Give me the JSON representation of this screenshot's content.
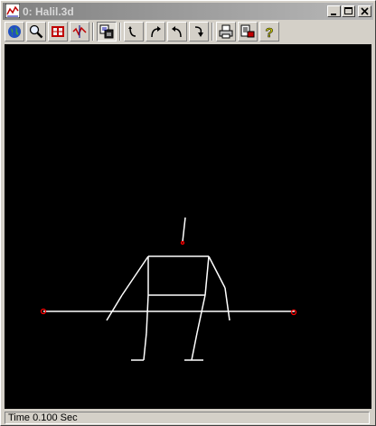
{
  "window": {
    "title": "0: Halil.3d",
    "caption_buttons": [
      "minimize",
      "maximize",
      "close"
    ]
  },
  "toolbar": {
    "groups": [
      [
        "globe-icon",
        "zoom-magnifier-icon",
        "film-frames-icon",
        "graph-chart-icon"
      ],
      [
        "model-view-icon"
      ],
      [
        "rotate-down-icon",
        "rotate-left-icon",
        "rotate-right-icon",
        "rotate-up-icon"
      ],
      [
        "print-icon",
        "print-preview-icon",
        "help-icon"
      ]
    ]
  },
  "status": {
    "text": "Time 0.100 Sec"
  },
  "viewport": {
    "background": "#000000",
    "line_color": "#ffffff",
    "marker_color": "#ff0000"
  }
}
